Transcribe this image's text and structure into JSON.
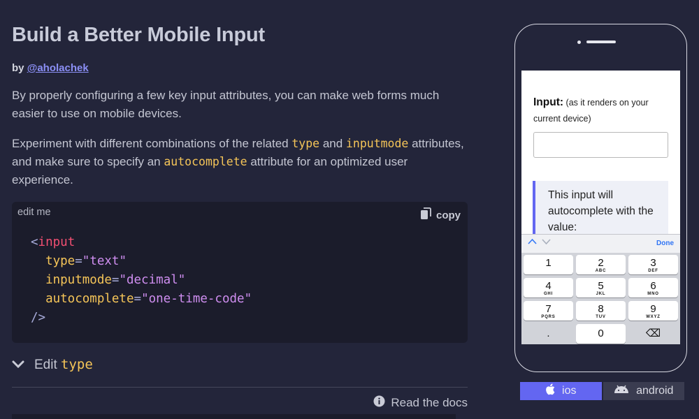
{
  "article": {
    "title": "Build a Better Mobile Input",
    "byline_prefix": "by",
    "author": "@aholachek",
    "p1": "By properly configuring a few key input attributes, you can make web forms much easier to use on mobile devices.",
    "p2_a": "Experiment with different combinations of the related",
    "p2_code1": "type",
    "p2_b": "and",
    "p2_code2": "inputmode",
    "p2_c": "attributes, and make sure to specify an",
    "p2_code3": "autocomplete",
    "p2_d": "attribute for an optimized user experience."
  },
  "editor": {
    "label": "edit me",
    "copy_label": "copy",
    "tag_open": "<",
    "tag_name": "input",
    "attrs": [
      {
        "name": "type",
        "value": "\"text\""
      },
      {
        "name": "inputmode",
        "value": "\"decimal\""
      },
      {
        "name": "autocomplete",
        "value": "\"one-time-code\""
      }
    ],
    "tag_close": "/>"
  },
  "edit_section": {
    "label": "Edit",
    "code": "type"
  },
  "docs_link": "Read the docs",
  "phone": {
    "input_label": "Input:",
    "input_sublabel": "(as it renders on your current device)",
    "input_value": "",
    "note": "This input will autocomplete with the value:",
    "kb_done": "Done",
    "keys": [
      {
        "num": "1",
        "letters": ""
      },
      {
        "num": "2",
        "letters": "ABC"
      },
      {
        "num": "3",
        "letters": "DEF"
      },
      {
        "num": "4",
        "letters": "GHI"
      },
      {
        "num": "5",
        "letters": "JKL"
      },
      {
        "num": "6",
        "letters": "MNO"
      },
      {
        "num": "7",
        "letters": "PQRS"
      },
      {
        "num": "8",
        "letters": "TUV"
      },
      {
        "num": "9",
        "letters": "WXYZ"
      },
      {
        "num": ".",
        "letters": ""
      },
      {
        "num": "0",
        "letters": ""
      },
      {
        "num": "⌫",
        "letters": ""
      }
    ]
  },
  "platform_switch": {
    "ios_label": "ios",
    "android_label": "android",
    "selected": "ios",
    "selected_color": "#6366f1"
  }
}
